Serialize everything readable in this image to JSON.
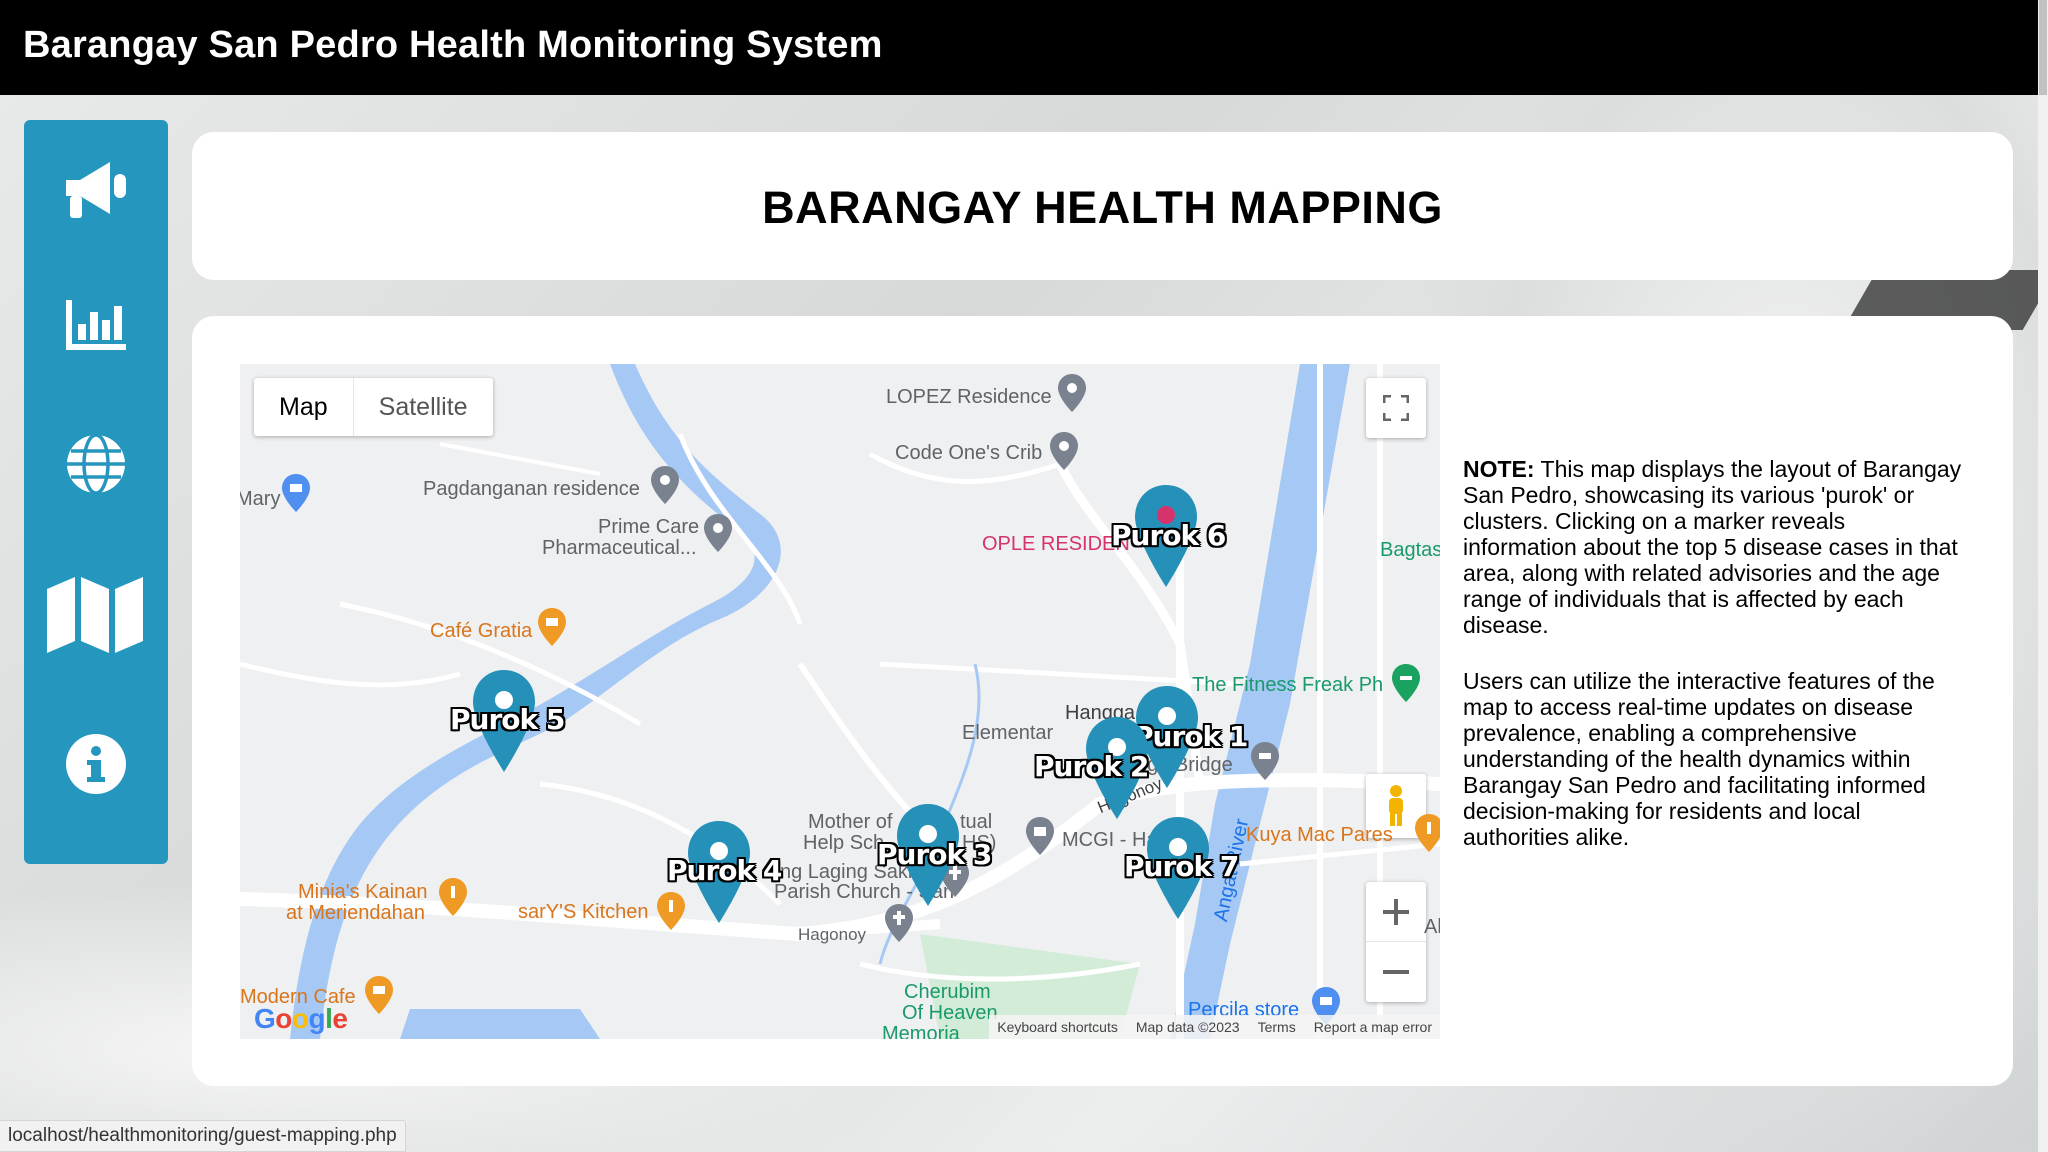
{
  "app": {
    "title": "Barangay San Pedro Health Monitoring System"
  },
  "sidebar": {
    "items": [
      {
        "icon": "megaphone-icon"
      },
      {
        "icon": "bar-chart-icon"
      },
      {
        "icon": "globe-icon"
      },
      {
        "icon": "map-icon"
      },
      {
        "icon": "info-icon"
      }
    ]
  },
  "page": {
    "heading": "BARANGAY HEALTH MAPPING"
  },
  "map": {
    "type_controls": {
      "map": "Map",
      "satellite": "Satellite"
    },
    "puroks": [
      "Purok 1",
      "Purok 2",
      "Purok 3",
      "Purok 4",
      "Purok 5",
      "Purok 6",
      "Purok 7"
    ],
    "places": {
      "lopez": "LOPEZ Residence",
      "codeone": "Code One's Crib",
      "pagdanganan": "Pagdanganan residence",
      "primecare1": "Prime Care",
      "primecare2": "Pharmaceutical...",
      "mary": "Mary",
      "opleresiden": "OPLE RESIDEN",
      "bagtas": "Bagtas",
      "cafegratia": "Café Gratia",
      "fitness": "The Fitness Freak Ph",
      "hangga": "Hangga",
      "elementary": "Elementar",
      "school": "ool",
      "bridge": "gga Bridge",
      "hagonoy1": "Hagonoy",
      "hagonoy2": "Hagonoy",
      "mcgi": "MCGI - Ha",
      "kuyamac": "Kuya Mac Pares",
      "motherof": "Mother of",
      "tual": "tual",
      "helpsch": "Help Sch",
      "hs": "HS)",
      "laging": "ng Laging Saklo",
      "parish": "Parish Church - San",
      "minia1": "Minia's Kainan",
      "minia2": "at Meriendahan",
      "sary": "sarY'S Kitchen",
      "angat": "Angat River",
      "cherubim1": "Cherubim",
      "cherubim2": "Of Heaven",
      "cherubim3": "Memoria",
      "modern": "Modern Cafe",
      "percila": "Percila store",
      "al": "Al"
    },
    "footer": {
      "keyboard": "Keyboard shortcuts",
      "mapdata": "Map data ©2023",
      "terms": "Terms",
      "report": "Report a map error"
    },
    "logo": "Google"
  },
  "note": {
    "label": "NOTE:",
    "p1": "This map displays the layout of Barangay San Pedro, showcasing its various 'purok' or clusters. Clicking on a marker reveals information about the top 5 disease cases in that area, along with related advisories and the age range of individuals that is affected by each disease.",
    "p2": "Users can utilize the interactive features of the map to access real-time updates on disease prevalence, enabling a comprehensive understanding of the health dynamics within Barangay San Pedro and facilitating informed decision-making for residents and local authorities alike."
  },
  "status": {
    "url": "localhost/healthmonitoring/guest-mapping.php"
  },
  "colors": {
    "sidebar": "#2596be",
    "marker": "#2590b8",
    "river": "#a6c8f5",
    "topbar": "#000000"
  }
}
